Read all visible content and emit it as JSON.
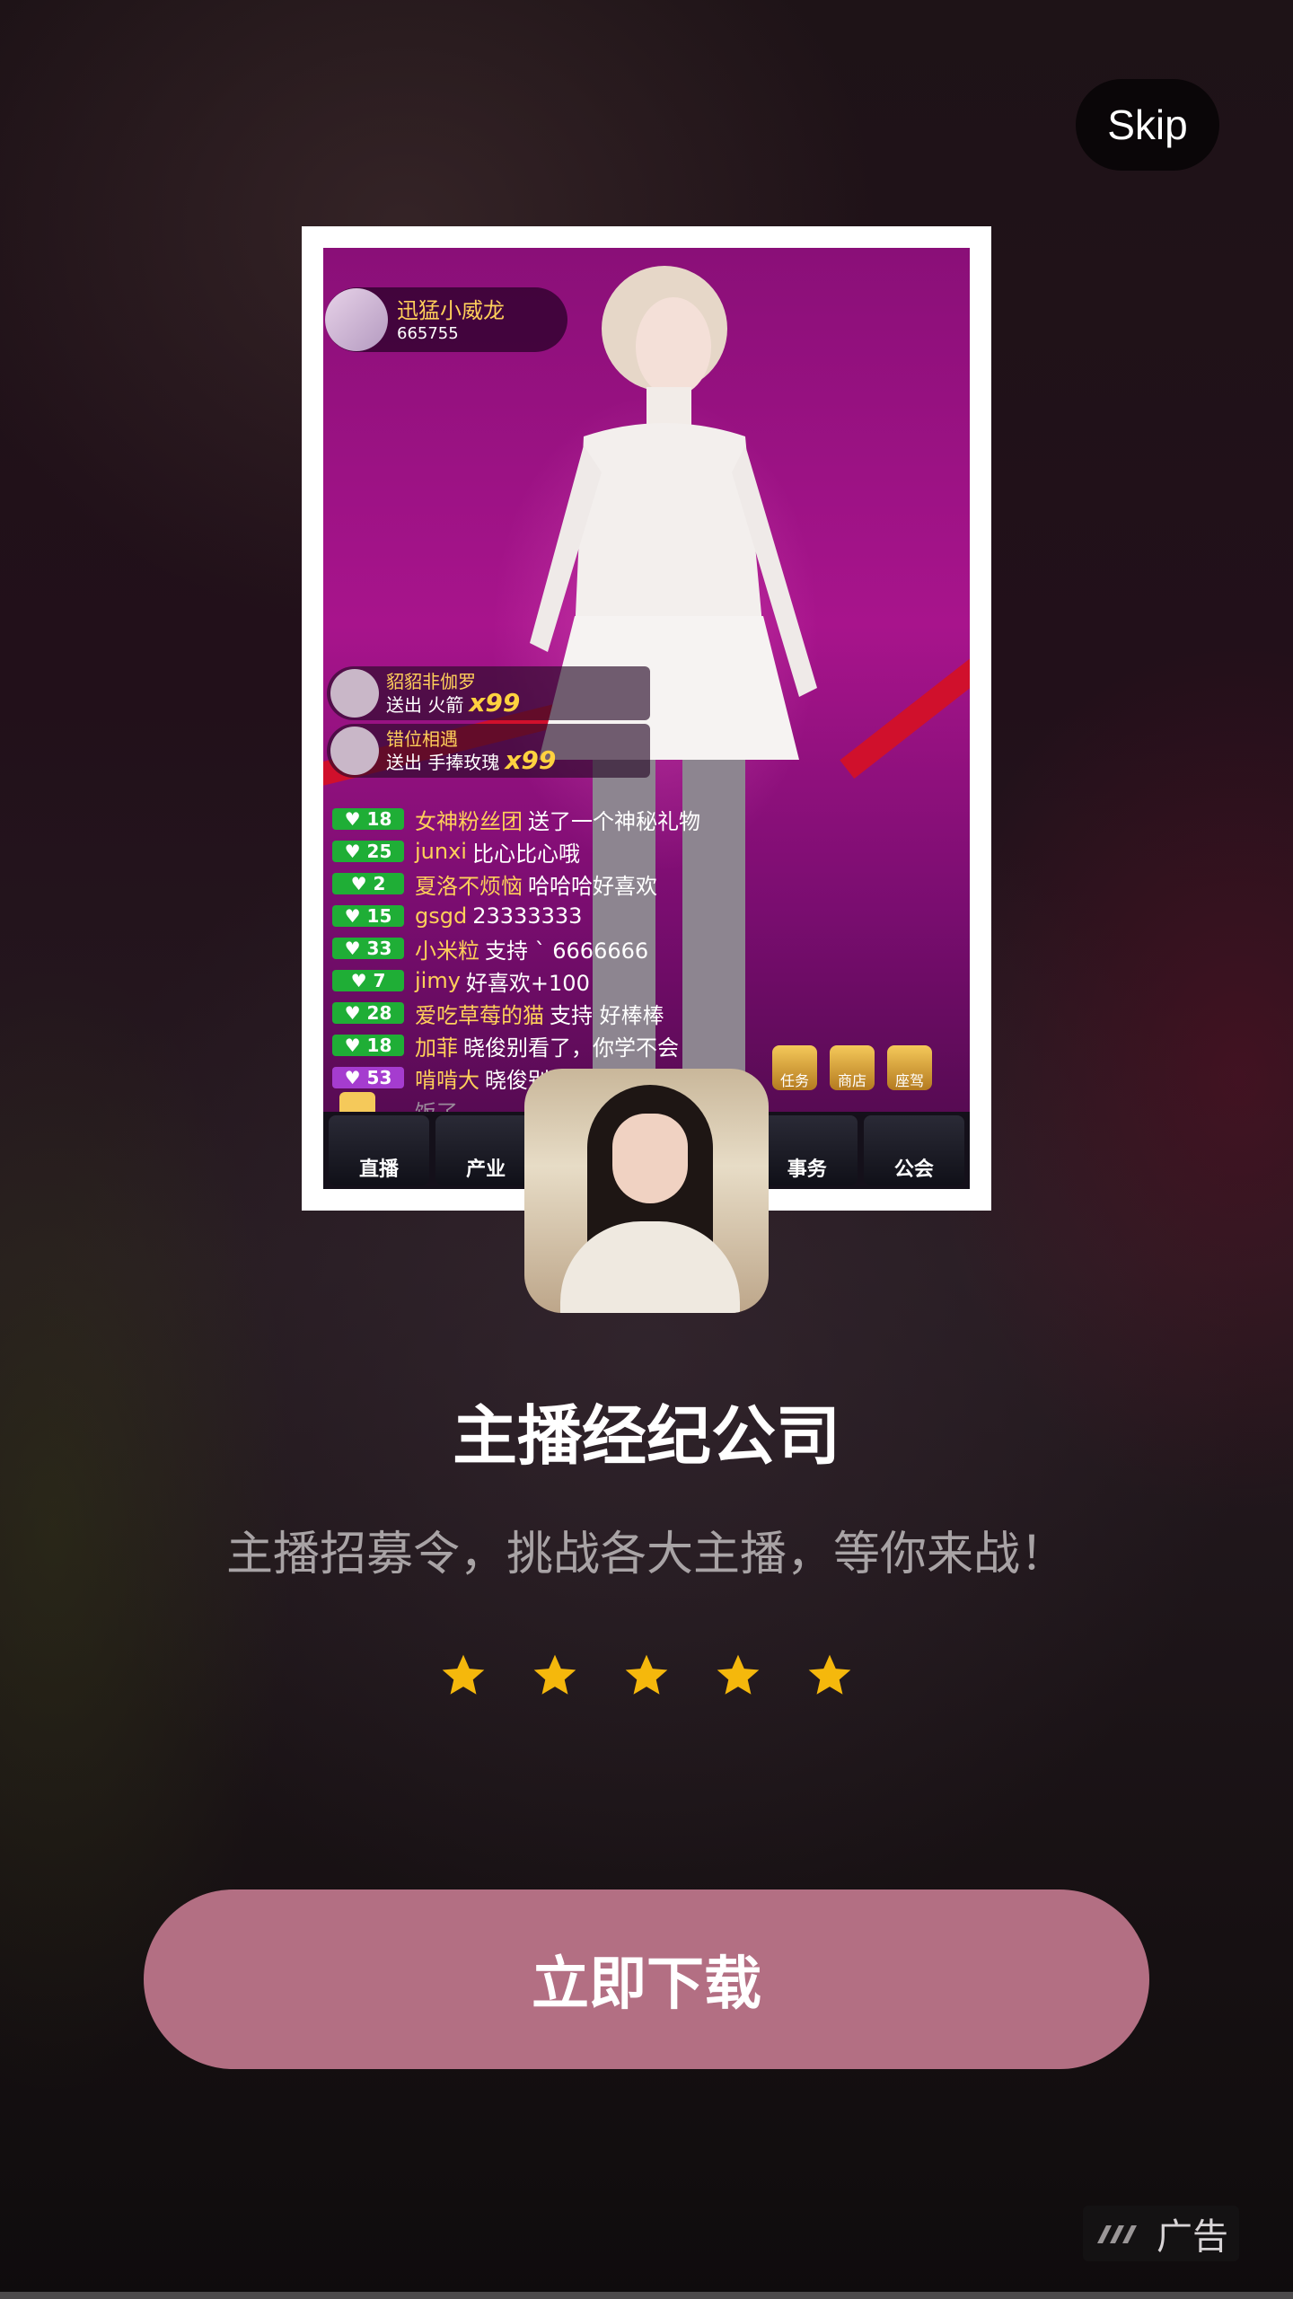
{
  "skip_label": "Skip",
  "screenshot": {
    "host_name": "迅猛小威龙",
    "host_fans": "665755",
    "gifts": [
      {
        "name": "貂貂非伽罗",
        "text": "送出 火箭",
        "count": "x99"
      },
      {
        "name": "错位相遇",
        "text": "送出 手捧玫瑰",
        "count": "x99"
      }
    ],
    "chat": [
      {
        "level": "18",
        "name": "女神粉丝团",
        "msg": "送了一个神秘礼物"
      },
      {
        "level": "25",
        "name": "junxi",
        "msg": "比心比心哦"
      },
      {
        "level": "2",
        "name": "夏洛不烦恼",
        "msg": "哈哈哈好喜欢"
      },
      {
        "level": "15",
        "name": "gsgd",
        "msg": "23333333"
      },
      {
        "level": "33",
        "name": "小米粒",
        "msg": "支持 ` 6666666"
      },
      {
        "level": "7",
        "name": "jimy",
        "msg": "好喜欢+100"
      },
      {
        "level": "28",
        "name": "爱吃草莓的猫",
        "msg": "支持 好棒棒"
      },
      {
        "level": "18",
        "name": "加菲",
        "msg": "晓俊别看了，你学不会"
      },
      {
        "level": "53",
        "name": "啃啃大",
        "msg": "晓俊别看了，你滚去做"
      }
    ],
    "chat_tail": "饭了",
    "shop_icons": [
      "任务",
      "商店",
      "座驾"
    ],
    "bottom_buttons": [
      "直播",
      "产业",
      "",
      "",
      "事务",
      "公会"
    ]
  },
  "app_title": "主播经纪公司",
  "app_subtitle": "主播招募令，挑战各大主播，等你来战！",
  "rating": 5,
  "download_label": "立即下载",
  "ad_label": "广告",
  "colors": {
    "download_button": "#b36f83",
    "star": "#f5b80c"
  },
  "icons": {
    "skip": "skip-button",
    "star": "star-icon",
    "ad_logo": "ad-logo-icon"
  }
}
